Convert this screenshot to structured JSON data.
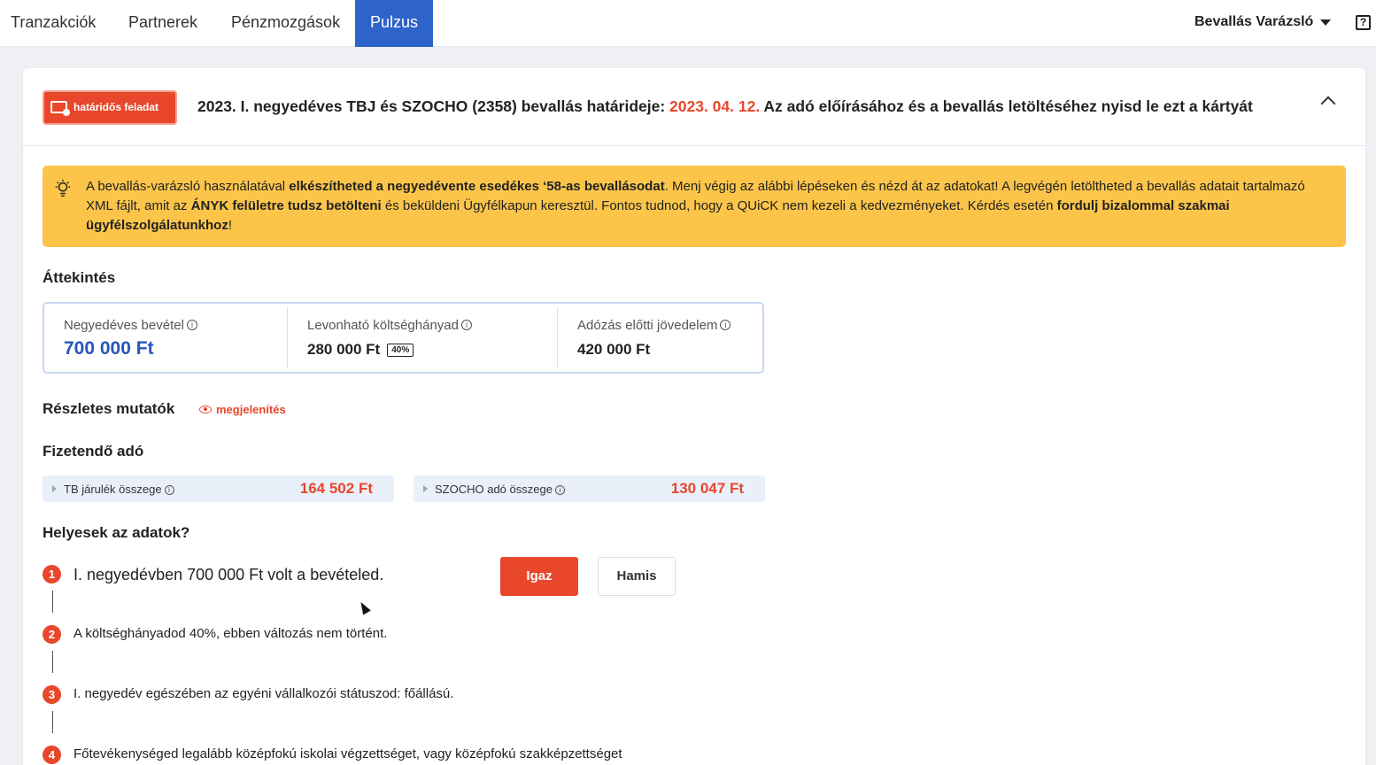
{
  "nav": {
    "tabs": [
      {
        "label": "Tranzakciók"
      },
      {
        "label": "Partnerek"
      },
      {
        "label": "Pénzmozgások"
      },
      {
        "label": "Pulzus",
        "active": true
      }
    ],
    "wizard_label": "Bevallás Varázsló",
    "help_label": "?"
  },
  "card": {
    "badge": "határidős feladat",
    "headline_pre": "2023. I. negyedéves TBJ és SZOCHO (2358) bevallás határideje: ",
    "headline_date": "2023. 04. 12.",
    "headline_post": " Az adó előírásához és a bevallás letöltéséhez nyisd le ezt a kártyát"
  },
  "notice": {
    "t1": "A bevallás-varázsló használatával ",
    "b1": "elkészítheted a negyedévente esedékes ‘58-as bevallásodat",
    "t2": ". Menj végig az alábbi lépéseken és nézd át az adatokat! A legvégén letöltheted a bevallás adatait tartalmazó XML fájlt, amit az ",
    "b2": "ÁNYK felületre tudsz betölteni",
    "t3": " és beküldeni Ügyfélkapun keresztül. Fontos tudnod, hogy a QUiCK nem kezeli a kedvezményeket. Kérdés esetén ",
    "b3": "fordulj bizalommal szakmai ügyfélszolgálatunkhoz",
    "t4": "!"
  },
  "overview": {
    "title": "Áttekintés",
    "items": [
      {
        "label": "Negyedéves bevétel",
        "value": "700 000 Ft"
      },
      {
        "label": "Levonható költséghányad",
        "value": "280 000 Ft",
        "badge": "40%"
      },
      {
        "label": "Adózás előtti jövedelem",
        "value": "420 000 Ft"
      }
    ]
  },
  "details": {
    "title": "Részletes mutatók",
    "show_label": "megjelenítés"
  },
  "tax": {
    "title": "Fizetendő adó",
    "items": [
      {
        "label": "TB járulék összege",
        "amount": "164 502 Ft"
      },
      {
        "label": "SZOCHO adó összege",
        "amount": "130 047 Ft"
      }
    ]
  },
  "check": {
    "title": "Helyesek az adatok?",
    "true_label": "Igaz",
    "false_label": "Hamis",
    "steps": [
      {
        "num": "1",
        "text": "I. negyedévben 700 000 Ft volt a bevételed."
      },
      {
        "num": "2",
        "text": "A költséghányadod 40%, ebben változás nem történt."
      },
      {
        "num": "3",
        "text": "I. negyedév egészében az egyéni vállalkozói státuszod: főállású."
      },
      {
        "num": "4",
        "text": "Főtevékenységed legalább középfokú iskolai végzettséget, vagy középfokú szakképzettséget"
      }
    ]
  },
  "info_glyph": "i"
}
